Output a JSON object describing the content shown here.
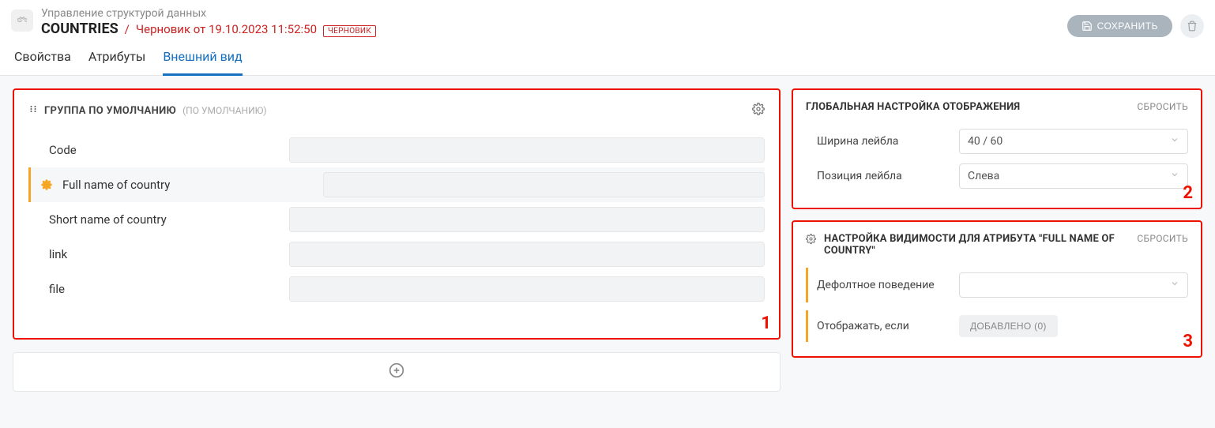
{
  "header": {
    "breadcrumb": "Управление структурой данных",
    "title": "COUNTRIES",
    "separator": "/",
    "draft": "Черновик от 19.10.2023 11:52:50",
    "badge": "ЧЕРНОВИК",
    "save": "СОХРАНИТЬ"
  },
  "tabs": [
    {
      "label": "Свойства",
      "active": false
    },
    {
      "label": "Атрибуты",
      "active": false
    },
    {
      "label": "Внешний вид",
      "active": true
    }
  ],
  "group": {
    "title": "ГРУППА ПО УМОЛЧАНИЮ",
    "subtitle": "(ПО УМОЛЧАНИЮ)",
    "attributes": [
      {
        "label": "Code",
        "selected": false
      },
      {
        "label": "Full name of country",
        "selected": true
      },
      {
        "label": "Short name of country",
        "selected": false
      },
      {
        "label": "link",
        "selected": false
      },
      {
        "label": "file",
        "selected": false
      }
    ]
  },
  "globalPanel": {
    "title": "ГЛОБАЛЬНАЯ НАСТРОЙКА ОТОБРАЖЕНИЯ",
    "reset": "СБРОСИТЬ",
    "labelWidthLabel": "Ширина лейбла",
    "labelWidthValue": "40 / 60",
    "labelPosLabel": "Позиция лейбла",
    "labelPosValue": "Слева"
  },
  "visibilityPanel": {
    "title": "НАСТРОЙКА ВИДИМОСТИ ДЛЯ АТРИБУТА \"FULL NAME OF COUNTRY\"",
    "reset": "СБРОСИТЬ",
    "defaultLabel": "Дефолтное поведение",
    "defaultValue": "",
    "showIfLabel": "Отображать, если",
    "addedChip": "ДОБАВЛЕНО (0)"
  },
  "annotations": {
    "one": "1",
    "two": "2",
    "three": "3"
  }
}
